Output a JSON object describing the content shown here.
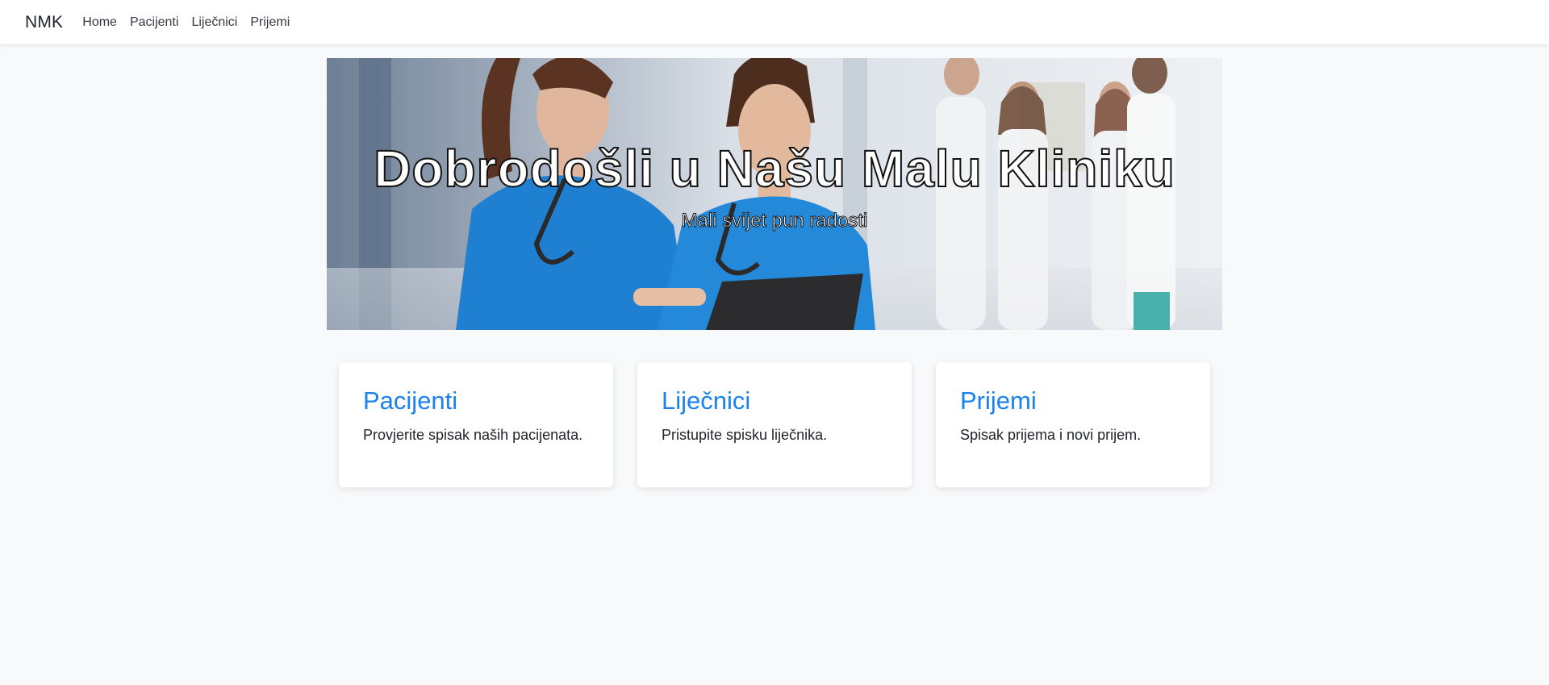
{
  "navbar": {
    "brand": "NMK",
    "links": [
      "Home",
      "Pacijenti",
      "Liječnici",
      "Prijemi"
    ]
  },
  "hero": {
    "title": "Dobrodošli u Našu Malu Kliniku",
    "subtitle": "Mali svijet pun radosti",
    "image": "medical-staff-photo"
  },
  "cards": [
    {
      "title": "Pacijenti",
      "text": "Provjerite spisak naših pacijenata."
    },
    {
      "title": "Liječnici",
      "text": "Pristupite spisku liječnika."
    },
    {
      "title": "Prijemi",
      "text": "Spisak prijema i novi prijem."
    }
  ],
  "colors": {
    "accent": "#1a82f0",
    "background": "#f8f9fa",
    "scrubs": "#1f7fd0"
  }
}
